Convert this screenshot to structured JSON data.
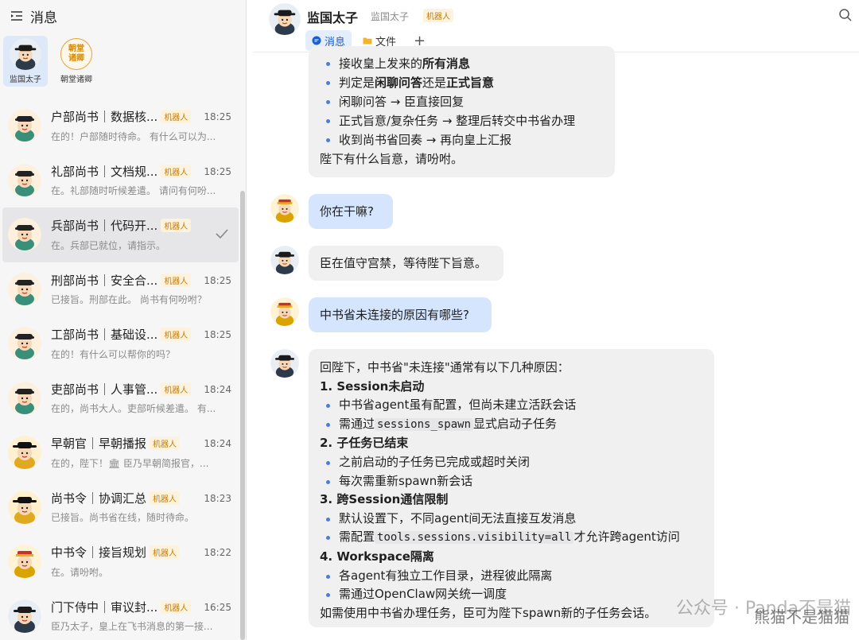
{
  "sidebar": {
    "title": "消息",
    "pinned": [
      {
        "label": "监国太子",
        "active": true
      },
      {
        "label": "朝堂诸卿",
        "seal_text": "朝堂\n诸卿",
        "active": false
      }
    ],
    "conversations": [
      {
        "name": "户部尚书｜数据核...",
        "badge": "机器人",
        "time": "18:25",
        "preview": "在的！户部随时待命。 有什么可以为...",
        "seal": "户"
      },
      {
        "name": "礼部尚书｜文档规...",
        "badge": "机器人",
        "time": "18:25",
        "preview": "在。礼部随时听候差遣。 请问有何吩...",
        "seal": "礼"
      },
      {
        "name": "兵部尚书｜代码开...",
        "badge": "机器人",
        "time": "",
        "preview": "在。兵部已就位，请指示。",
        "seal": "兵",
        "selected": true
      },
      {
        "name": "刑部尚书｜安全合...",
        "badge": "机器人",
        "time": "18:25",
        "preview": "已接旨。刑部在此。 尚书有何吩咐？",
        "seal": "刑"
      },
      {
        "name": "工部尚书｜基础设...",
        "badge": "机器人",
        "time": "18:25",
        "preview": "在的！有什么可以帮你的吗？",
        "seal": "工"
      },
      {
        "name": "吏部尚书｜人事管...",
        "badge": "机器人",
        "time": "18:24",
        "preview": "在的，尚书大人。吏部听候差遣。 有...",
        "seal": "吏"
      },
      {
        "name": "早朝官｜早朝播报",
        "badge": "机器人",
        "time": "18:24",
        "preview": "在的，陛下！🏛 臣乃早朝简报官，...",
        "seal": ""
      },
      {
        "name": "尚书令｜协调汇总",
        "badge": "机器人",
        "time": "18:23",
        "preview": "已接旨。尚书省在线，随时待命。",
        "seal": ""
      },
      {
        "name": "中书令｜接旨规划",
        "badge": "机器人",
        "time": "18:22",
        "preview": "在。请吩咐。",
        "seal": ""
      },
      {
        "name": "门下侍中｜审议封...",
        "badge": "机器人",
        "time": "16:25",
        "preview": "臣乃太子，皇上在飞书消息的第一接...",
        "seal": ""
      }
    ]
  },
  "header": {
    "name": "监国太子",
    "sub": "监国太子",
    "badge": "机器人",
    "tabs": [
      "消息",
      "文件"
    ],
    "add": "+"
  },
  "chat": {
    "first_bubble": {
      "items": [
        [
          "接收皇上发来的",
          "所有消息",
          ""
        ],
        [
          "判定是",
          "闲聊问答",
          "还是",
          "正式旨意",
          ""
        ],
        [
          "闲聊问答 → 臣直接回复"
        ],
        [
          "正式旨意/复杂任务 → 整理后转交中书省办理"
        ],
        [
          "收到尚书省回奏 → 再向皇上汇报"
        ]
      ],
      "tail": "陛下有什么旨意，请吩咐。"
    },
    "user1": "你在干嘛?",
    "bot1": "臣在值守宫禁，等待陛下旨意。",
    "user2": "中书省未连接的原因有哪些?",
    "bot2": {
      "intro": "回陛下，中书省\"未连接\"通常有以下几种原因：",
      "s1_title": "1. Session未启动",
      "s1_a": "中书省agent虽有配置，但尚未建立活跃会话",
      "s1_b_pre": "需通过",
      "s1_b_code": "sessions_spawn",
      "s1_b_post": "显式启动子任务",
      "s2_title": "2. 子任务已结束",
      "s2_a": "之前启动的子任务已完成或超时关闭",
      "s2_b": "每次需重新spawn新会话",
      "s3_title": "3. 跨Session通信限制",
      "s3_a": "默认设置下，不同agent间无法直接互发消息",
      "s3_b_pre": "需配置",
      "s3_b_code": "tools.sessions.visibility=all",
      "s3_b_post": "才允许跨agent访问",
      "s4_title": "4. Workspace隔离",
      "s4_a": "各agent有独立工作目录，进程彼此隔离",
      "s4_b": "需通过OpenClaw网关统一调度",
      "outro": "如需使用中书省办理任务，臣可为陛下spawn新的子任务会话。"
    }
  },
  "watermark": "公众号 · Panda不是猫",
  "watermark2": "熊猫不是猫猫",
  "colors": {
    "accent": "#1a5fd1",
    "badge": "#c27c0e",
    "user_bubble": "#d5e5fd",
    "bot_bubble": "#f0f0f1"
  }
}
